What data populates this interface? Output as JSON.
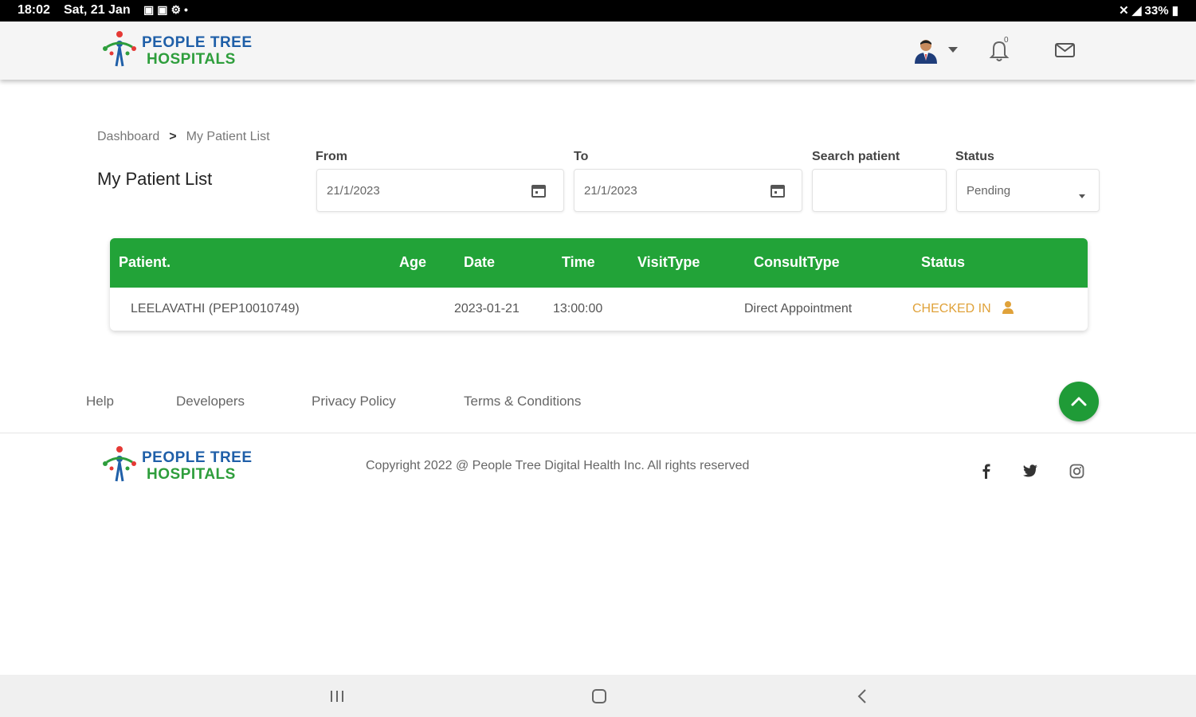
{
  "status_bar": {
    "time": "18:02",
    "date": "Sat, 21 Jan",
    "battery": "33%"
  },
  "brand": {
    "line1": "PEOPLE TREE",
    "line2": "HOSPITALS"
  },
  "header": {
    "notification_count": "0",
    "icons": [
      "avatar",
      "chevron-down-icon",
      "bell-icon",
      "mail-icon"
    ]
  },
  "breadcrumb": {
    "items": [
      "Dashboard",
      "My Patient List"
    ]
  },
  "page_title": "My Patient List",
  "filters": {
    "from_label": "From",
    "from_value": "21/1/2023",
    "to_label": "To",
    "to_value": "21/1/2023",
    "search_label": "Search patient",
    "search_value": "",
    "status_label": "Status",
    "status_value": "Pending"
  },
  "table": {
    "headers": [
      "Patient.",
      "Age",
      "Date",
      "Time",
      "VisitType",
      "ConsultType",
      "Status"
    ],
    "rows": [
      {
        "patient": "LEELAVATHI (PEP10010749)",
        "age": "",
        "date": "2023-01-21",
        "time": "13:00:00",
        "visit_type": "",
        "consult_type": "Direct Appointment",
        "status": "CHECKED IN"
      }
    ]
  },
  "footer": {
    "links": [
      "Help",
      "Developers",
      "Privacy Policy",
      "Terms & Conditions"
    ],
    "copyright": "Copyright 2022 @ People Tree Digital Health Inc. All rights reserved",
    "social": [
      "facebook-icon",
      "twitter-icon",
      "instagram-icon"
    ]
  },
  "colors": {
    "brand_green": "#22a338",
    "brand_blue": "#1f5fa8",
    "status_checked_in": "#e0a23a"
  }
}
